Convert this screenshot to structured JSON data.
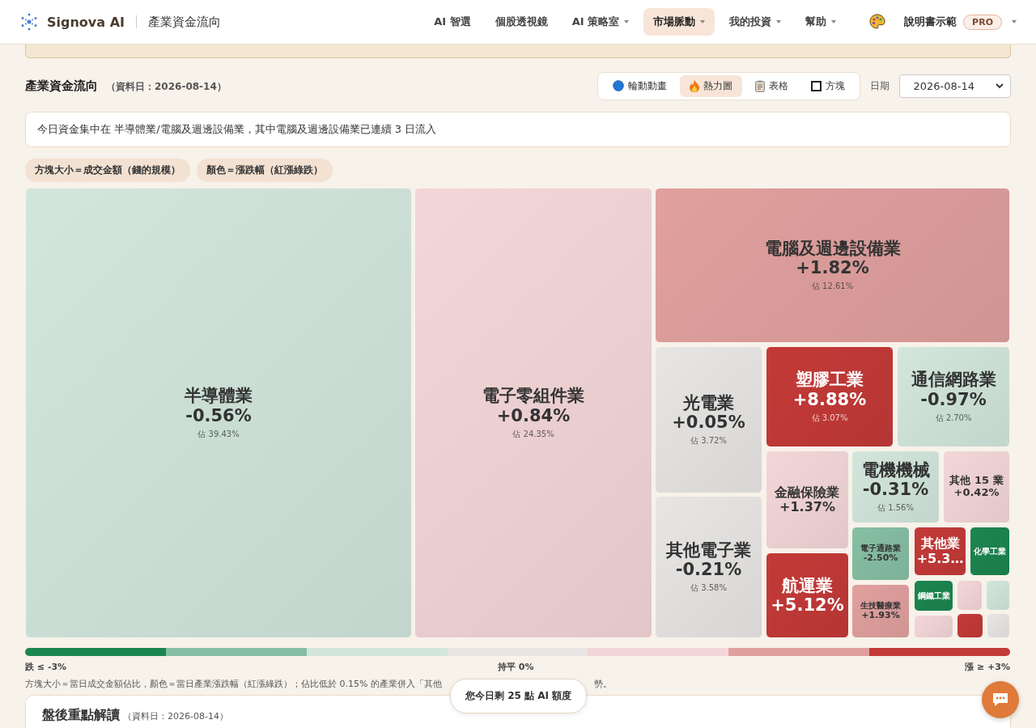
{
  "header": {
    "brand": "Signova AI",
    "page_title": "產業資金流向",
    "nav": [
      {
        "label": "AI 智選",
        "dropdown": false,
        "selected": false
      },
      {
        "label": "個股透視鏡",
        "dropdown": false,
        "selected": false
      },
      {
        "label": "AI 策略室",
        "dropdown": true,
        "selected": false
      },
      {
        "label": "市場脈動",
        "dropdown": true,
        "selected": true
      },
      {
        "label": "我的投資",
        "dropdown": true,
        "selected": false
      },
      {
        "label": "幫助",
        "dropdown": true,
        "selected": false
      }
    ],
    "user": "說明書示範",
    "badge": "PRO"
  },
  "section": {
    "title": "產業資金流向",
    "date_note": "（資料日：2026-08-14）",
    "views": [
      {
        "label": "輪動動畫",
        "kind": "animation",
        "selected": false
      },
      {
        "label": "熱力圖",
        "kind": "heatmap",
        "selected": true
      },
      {
        "label": "表格",
        "kind": "table",
        "selected": false
      },
      {
        "label": "方塊",
        "kind": "blocks",
        "selected": false
      }
    ],
    "date_label": "日期",
    "date_value": "2026-08-14"
  },
  "summary": "今日資金集中在 半導體業/電腦及週邊設備業，其中電腦及週邊設備業已連續 3 日流入",
  "chips": [
    "方塊大小＝成交金額（錢的規模）",
    "顏色＝漲跌幅（紅漲綠跌）"
  ],
  "tiles": [
    {
      "name": "半導體業",
      "change": "-0.56%",
      "share": "佔 39.43%",
      "color": "#d2e6dc"
    },
    {
      "name": "電子零組件業",
      "change": "+0.84%",
      "share": "佔 24.35%",
      "color": "#f3d6d8"
    },
    {
      "name": "電腦及週邊設備業",
      "change": "+1.82%",
      "share": "佔 12.61%",
      "color": "#e0a09e"
    },
    {
      "name": "光電業",
      "change": "+0.05%",
      "share": "佔 3.72%",
      "color": "#e8e6e4"
    },
    {
      "name": "塑膠工業",
      "change": "+8.88%",
      "share": "佔 3.07%",
      "color": "#c33a38"
    },
    {
      "name": "通信網路業",
      "change": "-0.97%",
      "share": "佔 2.70%",
      "color": "#d2e6dc"
    },
    {
      "name": "其他電子業",
      "change": "-0.21%",
      "share": "佔 3.58%",
      "color": "#e8e6e4"
    },
    {
      "name": "金融保險業",
      "change": "+1.37%",
      "color": "#f3d6d8"
    },
    {
      "name": "電機機械",
      "change": "-0.31%",
      "share": "佔 1.56%",
      "color": "#d2e6dc"
    },
    {
      "name": "其他 15 業",
      "change": "+0.42%",
      "color": "#f3d6d8"
    },
    {
      "name": "航運業",
      "change": "+5.12%",
      "color": "#c33a38"
    },
    {
      "name": "電子通路業",
      "change": "-2.50%",
      "color": "#86bfa3"
    },
    {
      "name": "其他業",
      "change": "+5.3…",
      "color": "#c33a38"
    },
    {
      "name": "化學工業",
      "color": "#1c8550"
    },
    {
      "name": "生技醫療業",
      "change": "+1.93%",
      "color": "#e0a09e"
    },
    {
      "name": "鋼鐵工業",
      "color": "#1c8550"
    },
    {
      "color": "#f3d6d8"
    },
    {
      "color": "#d2e6dc"
    },
    {
      "color": "#f3d6d8"
    },
    {
      "color": "#c33a38"
    },
    {
      "color": "#e8e6e4"
    }
  ],
  "scale": {
    "segments": [
      {
        "color": "#1c8550"
      },
      {
        "color": "#86bfa3"
      },
      {
        "color": "#d2e6dc"
      },
      {
        "color": "#e8e6e4"
      },
      {
        "color": "#f3d6d8"
      },
      {
        "color": "#e0a09e"
      },
      {
        "color": "#c33a38"
      }
    ],
    "low": "跌 ≤ -3%",
    "mid": "持平 0%",
    "high": "漲 ≥ +3%"
  },
  "footnote": [
    "方塊大小＝當日成交金額佔比，顏色＝當日產業漲跌幅（紅漲綠跌）；佔比低於 0.15% 的產業併入「其他",
    "勢。"
  ],
  "quota": "您今日剩 25 點 AI 額度",
  "review": {
    "title": "盤後重點解讀",
    "date_note": "（資料日：2026-08-14）"
  }
}
